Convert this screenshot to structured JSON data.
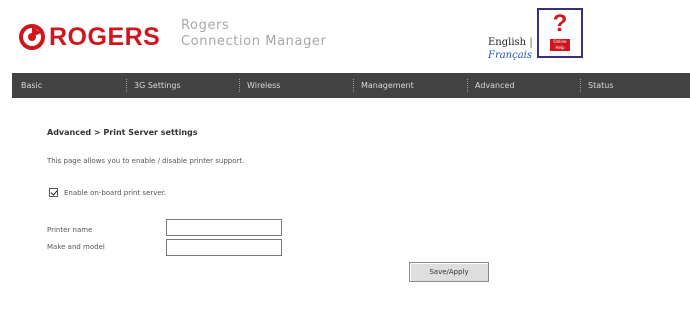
{
  "brand": {
    "logo_text": "ROGERS",
    "product_line1": "Rogers",
    "product_line2": "Connection Manager",
    "logo_color": "#d0161d"
  },
  "language": {
    "english": "English",
    "separator": "|",
    "french": "Français"
  },
  "help": {
    "symbol": "?",
    "label": "Online Help"
  },
  "nav": {
    "items": [
      {
        "label": "Basic"
      },
      {
        "label": "3G Settings"
      },
      {
        "label": "Wireless"
      },
      {
        "label": "Management"
      },
      {
        "label": "Advanced"
      },
      {
        "label": "Status"
      }
    ],
    "background": "#424242"
  },
  "page": {
    "breadcrumb": "Advanced > Print Server settings",
    "description": "This page allows you to enable / disable printer support.",
    "enable_label": "Enable on-board print server.",
    "enable_checked": true,
    "printer_name_label": "Printer name",
    "printer_name_value": "",
    "make_model_label": "Make and model",
    "make_model_value": "",
    "save_button": "Save/Apply"
  }
}
